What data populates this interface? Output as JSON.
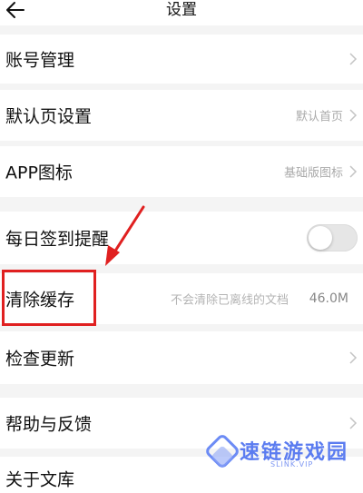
{
  "header": {
    "title": "设置",
    "back_icon": "arrow-left-icon"
  },
  "settings": {
    "account": {
      "label": "账号管理",
      "icon": "chevron-right-icon"
    },
    "default_page": {
      "label": "默认页设置",
      "value": "默认首页",
      "icon": "chevron-right-icon"
    },
    "app_icon": {
      "label": "APP图标",
      "value": "基础版图标",
      "icon": "chevron-right-icon"
    },
    "daily_checkin": {
      "label": "每日签到提醒",
      "toggle_on": false
    },
    "clear_cache": {
      "label": "清除缓存",
      "hint": "不会清除已离线的文档",
      "size": "46.0M"
    },
    "check_update": {
      "label": "检查更新",
      "icon": "chevron-right-icon"
    },
    "help": {
      "label": "帮助与反馈",
      "icon": "chevron-right-icon"
    },
    "about": {
      "label": "关于文库"
    }
  },
  "annotation": {
    "color": "#e02020"
  },
  "watermark": {
    "text": "速链游戏园",
    "sub": "SLINK.VIP",
    "color": "#5b7cf0"
  }
}
